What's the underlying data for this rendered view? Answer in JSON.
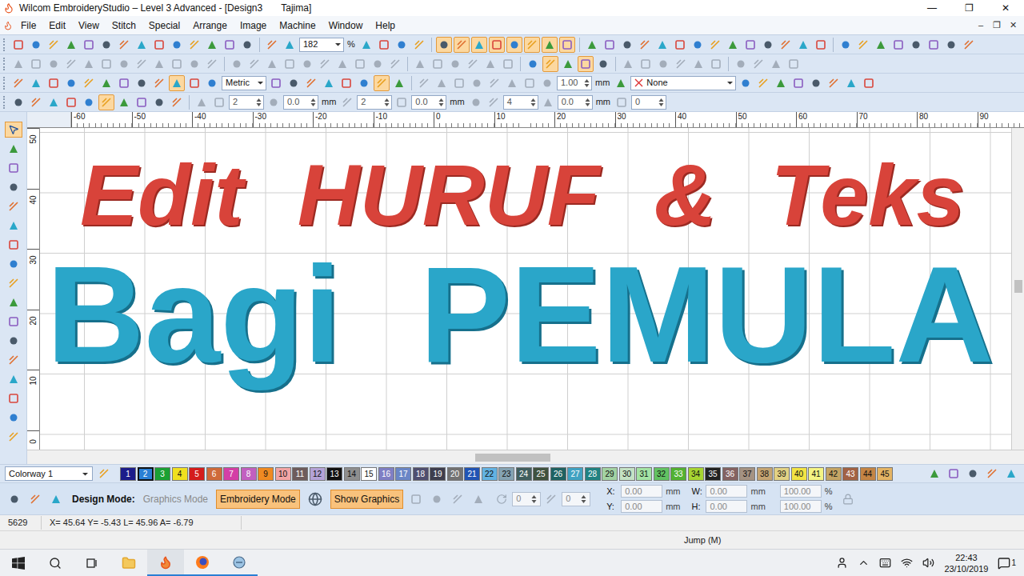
{
  "window": {
    "title": "Wilcom EmbroideryStudio – Level 3 Advanced - [Design3       Tajima]",
    "controls": [
      "—",
      "❐",
      "✕"
    ]
  },
  "menu": {
    "items": [
      "File",
      "Edit",
      "View",
      "Stitch",
      "Special",
      "Arrange",
      "Image",
      "Machine",
      "Window",
      "Help"
    ],
    "controls": [
      "–",
      "❐",
      "✕"
    ]
  },
  "toolbar_rows": [
    [
      {
        "kind": "buttons",
        "pressed": [
          false,
          false,
          false,
          false,
          false,
          false,
          false,
          false,
          false,
          false,
          false,
          false,
          false,
          false
        ],
        "disabled": false
      },
      {
        "kind": "sep"
      },
      {
        "kind": "buttons",
        "pressed": [
          false,
          false
        ],
        "disabled": false
      },
      {
        "kind": "combo",
        "value": "182"
      },
      {
        "kind": "text",
        "text": "%"
      },
      {
        "kind": "buttons",
        "pressed": [
          false,
          false,
          false,
          false
        ],
        "disabled": false
      },
      {
        "kind": "sep"
      },
      {
        "kind": "buttons",
        "pressed": [
          true,
          true,
          true,
          true,
          true,
          true,
          true,
          true
        ],
        "disabled": false
      },
      {
        "kind": "sep"
      },
      {
        "kind": "buttons",
        "pressed": [
          false,
          false,
          false,
          false,
          false,
          false,
          false,
          false,
          false,
          false,
          false,
          false,
          false,
          false
        ],
        "disabled": false
      },
      {
        "kind": "sep"
      },
      {
        "kind": "buttons",
        "pressed": [
          false,
          false,
          false,
          false,
          false
        ],
        "disabled": false
      },
      {
        "kind": "buttons",
        "pressed": [
          false,
          false,
          false
        ],
        "disabled": false
      }
    ],
    [
      {
        "kind": "buttons",
        "pressed": [
          false,
          false,
          false,
          false,
          false,
          false,
          false,
          false,
          false,
          false,
          false,
          false
        ],
        "disabled": true
      },
      {
        "kind": "sep"
      },
      {
        "kind": "buttons",
        "pressed": [
          false,
          false,
          false,
          false,
          false,
          false,
          false,
          false,
          false,
          false
        ],
        "disabled": true
      },
      {
        "kind": "sep"
      },
      {
        "kind": "buttons",
        "pressed": [
          false,
          false,
          false,
          false,
          false,
          false
        ],
        "disabled": true
      },
      {
        "kind": "sep"
      },
      {
        "kind": "buttons",
        "pressed": [
          false,
          true,
          false,
          true,
          false
        ],
        "disabled": false
      },
      {
        "kind": "sep"
      },
      {
        "kind": "buttons",
        "pressed": [
          false,
          false,
          false,
          false,
          false,
          false
        ],
        "disabled": true
      },
      {
        "kind": "sep"
      },
      {
        "kind": "buttons",
        "pressed": [
          false,
          false,
          false,
          false
        ],
        "disabled": true
      }
    ],
    [
      {
        "kind": "buttons",
        "pressed": [
          false,
          false,
          false,
          false,
          false,
          false,
          false,
          false,
          false,
          true,
          false,
          false
        ],
        "disabled": false
      },
      {
        "kind": "combo",
        "value": "Metric"
      },
      {
        "kind": "buttons",
        "pressed": [
          false,
          false,
          false,
          false,
          false,
          false,
          true,
          false
        ],
        "disabled": false
      },
      {
        "kind": "sep"
      },
      {
        "kind": "buttons",
        "pressed": [
          false,
          false,
          false,
          false,
          false,
          false,
          false,
          false
        ],
        "disabled": true
      },
      {
        "kind": "field",
        "value": "1.00"
      },
      {
        "kind": "text",
        "text": "mm"
      },
      {
        "kind": "buttons",
        "pressed": [
          false
        ],
        "disabled": false
      },
      {
        "kind": "listbox",
        "value": "None"
      },
      {
        "kind": "buttons",
        "pressed": [
          false,
          false,
          false,
          false,
          false,
          false,
          false,
          false
        ],
        "disabled": false
      }
    ],
    [
      {
        "kind": "buttons",
        "pressed": [
          false,
          false,
          false,
          false,
          false,
          true,
          false,
          false,
          false,
          false
        ],
        "disabled": false
      },
      {
        "kind": "sep"
      },
      {
        "kind": "buttons",
        "pressed": [
          false,
          false
        ],
        "disabled": true
      },
      {
        "kind": "field",
        "value": "2"
      },
      {
        "kind": "buttons",
        "pressed": [
          false
        ],
        "disabled": true
      },
      {
        "kind": "field",
        "value": "0.0"
      },
      {
        "kind": "text",
        "text": "mm"
      },
      {
        "kind": "buttons",
        "pressed": [
          false
        ],
        "disabled": true
      },
      {
        "kind": "field",
        "value": "2"
      },
      {
        "kind": "buttons",
        "pressed": [
          false
        ],
        "disabled": true
      },
      {
        "kind": "field",
        "value": "0.0"
      },
      {
        "kind": "text",
        "text": "mm"
      },
      {
        "kind": "buttons",
        "pressed": [
          false,
          false
        ],
        "disabled": true
      },
      {
        "kind": "field",
        "value": "4"
      },
      {
        "kind": "buttons",
        "pressed": [
          false
        ],
        "disabled": true
      },
      {
        "kind": "field",
        "value": "0.0"
      },
      {
        "kind": "text",
        "text": "mm"
      },
      {
        "kind": "buttons",
        "pressed": [
          false
        ],
        "disabled": true
      },
      {
        "kind": "field",
        "value": "0"
      }
    ]
  ],
  "left_toolbar": {
    "pressed": [
      true,
      false,
      false,
      false,
      false,
      false,
      false,
      false,
      false,
      false,
      false,
      false,
      false,
      false,
      false,
      false,
      false
    ]
  },
  "rulers": {
    "top": [
      "-60",
      "-50",
      "-40",
      "-30",
      "-20",
      "-10",
      "0",
      "10",
      "20",
      "30",
      "40",
      "50",
      "60",
      "70",
      "80",
      "90"
    ],
    "left": [
      "50",
      "40",
      "30",
      "20",
      "10",
      "0"
    ]
  },
  "design": {
    "lines": [
      {
        "text": "Edit HURUF & Teks",
        "color": "#d8433a",
        "kind": "script"
      },
      {
        "text": "Bagi PEMULA",
        "color": "#2aa6c9",
        "kind": "block"
      }
    ]
  },
  "colorway": {
    "label": "Colorway 1",
    "chips": [
      {
        "label": "1",
        "color": "#1c1c8a",
        "selected": false
      },
      {
        "label": "2",
        "color": "#2a7fd4",
        "selected": true
      },
      {
        "label": "3",
        "color": "#1aa033",
        "selected": false
      },
      {
        "label": "4",
        "color": "#f0e020",
        "selected": false
      },
      {
        "label": "5",
        "color": "#d41c1c",
        "selected": false
      },
      {
        "label": "6",
        "color": "#cf6a3a",
        "selected": false
      },
      {
        "label": "7",
        "color": "#d43fa6",
        "selected": false
      },
      {
        "label": "8",
        "color": "#c25fc0",
        "selected": false
      },
      {
        "label": "9",
        "color": "#ef8a22",
        "selected": false
      },
      {
        "label": "10",
        "color": "#f2a4a4",
        "selected": false
      },
      {
        "label": "11",
        "color": "#6e5c5c",
        "selected": false
      },
      {
        "label": "12",
        "color": "#b4a2d6",
        "selected": false
      },
      {
        "label": "13",
        "color": "#111111",
        "selected": false
      },
      {
        "label": "14",
        "color": "#8e8e8e",
        "selected": false
      },
      {
        "label": "15",
        "color": "#ffffff",
        "selected": false
      },
      {
        "label": "16",
        "color": "#7f7fc4",
        "selected": false
      },
      {
        "label": "17",
        "color": "#6a86c6",
        "selected": false
      },
      {
        "label": "18",
        "color": "#4f4f6f",
        "selected": false
      },
      {
        "label": "19",
        "color": "#3e3e4e",
        "selected": false
      },
      {
        "label": "20",
        "color": "#727272",
        "selected": false
      },
      {
        "label": "21",
        "color": "#2154b4",
        "selected": false
      },
      {
        "label": "22",
        "color": "#62b2e2",
        "selected": false
      },
      {
        "label": "23",
        "color": "#84a2b2",
        "selected": false
      },
      {
        "label": "24",
        "color": "#405e5e",
        "selected": false
      },
      {
        "label": "25",
        "color": "#3f523f",
        "selected": false
      },
      {
        "label": "26",
        "color": "#1f6262",
        "selected": false
      },
      {
        "label": "27",
        "color": "#40a2c2",
        "selected": false
      },
      {
        "label": "28",
        "color": "#218282",
        "selected": false
      },
      {
        "label": "29",
        "color": "#a2d2a2",
        "selected": false
      },
      {
        "label": "30",
        "color": "#c4e2c4",
        "selected": false
      },
      {
        "label": "31",
        "color": "#a4e4a4",
        "selected": false
      },
      {
        "label": "32",
        "color": "#62c262",
        "selected": false
      },
      {
        "label": "33",
        "color": "#52b232",
        "selected": false
      },
      {
        "label": "34",
        "color": "#a6d432",
        "selected": false
      },
      {
        "label": "35",
        "color": "#222222",
        "selected": false
      },
      {
        "label": "36",
        "color": "#846262",
        "selected": false
      },
      {
        "label": "37",
        "color": "#a49282",
        "selected": false
      },
      {
        "label": "38",
        "color": "#c4a472",
        "selected": false
      },
      {
        "label": "39",
        "color": "#e2d284",
        "selected": false
      },
      {
        "label": "40",
        "color": "#f2e444",
        "selected": false
      },
      {
        "label": "41",
        "color": "#f4f484",
        "selected": false
      },
      {
        "label": "42",
        "color": "#c4a464",
        "selected": false
      },
      {
        "label": "43",
        "color": "#a26244",
        "selected": false
      },
      {
        "label": "44",
        "color": "#c48444",
        "selected": false
      },
      {
        "label": "45",
        "color": "#e4b464",
        "selected": false
      }
    ]
  },
  "design_mode": {
    "label": "Design Mode:",
    "modes": [
      {
        "label": "Graphics Mode",
        "selected": false
      },
      {
        "label": "Embroidery Mode",
        "selected": true
      }
    ],
    "show_graphics": {
      "label": "Show Graphics",
      "on": true
    },
    "rotate": "0",
    "slant": "0",
    "position": [
      {
        "label": "X:",
        "value": "0.00",
        "unit": "mm"
      },
      {
        "label": "Y:",
        "value": "0.00",
        "unit": "mm"
      }
    ],
    "size": [
      {
        "label": "W:",
        "value": "0.00",
        "unit": "mm"
      },
      {
        "label": "H:",
        "value": "0.00",
        "unit": "mm"
      }
    ],
    "scale": [
      {
        "value": "100.00",
        "unit": "%"
      },
      {
        "value": "100.00",
        "unit": "%"
      }
    ]
  },
  "status_bar": {
    "stitch": "5629",
    "coords": "X= 45.64 Y= -5.43 L= 45.96 A= -6.79",
    "mode": "Jump (M)"
  },
  "taskbar": {
    "time": "22:43",
    "date": "23/10/2019",
    "notifications": "1"
  }
}
